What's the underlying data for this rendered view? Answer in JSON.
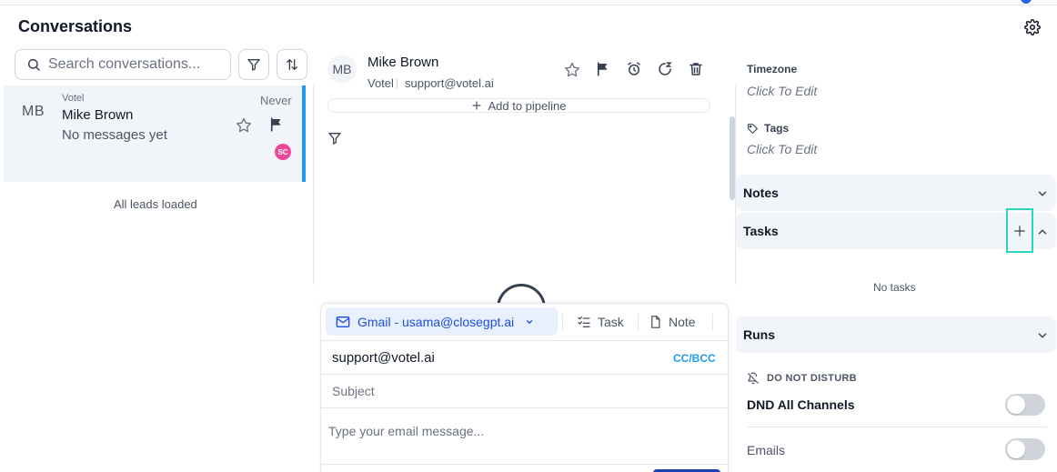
{
  "header": {
    "title": "Conversations"
  },
  "search": {
    "placeholder": "Search conversations..."
  },
  "conversation": {
    "avatar_initials": "MB",
    "company": "Votel",
    "name": "Mike Brown",
    "preview": "No messages yet",
    "time": "Never",
    "badge": "SC"
  },
  "list_status": "All leads loaded",
  "contact": {
    "initials": "MB",
    "name": "Mike Brown",
    "company": "Votel",
    "email": "support@votel.ai",
    "add_pipeline": "Add to pipeline"
  },
  "composer": {
    "channel": "Gmail - usama@closegpt.ai",
    "task_tab": "Task",
    "note_tab": "Note",
    "to": "support@votel.ai",
    "cc_bcc": "CC/BCC",
    "subject_placeholder": "Subject",
    "message_placeholder": "Type your email message..."
  },
  "details": {
    "timezone_label": "Timezone",
    "timezone_value": "Click To Edit",
    "tags_label": "Tags",
    "tags_value": "Click To Edit"
  },
  "sections": {
    "notes": "Notes",
    "tasks": "Tasks",
    "no_tasks": "No tasks",
    "runs": "Runs"
  },
  "dnd": {
    "title": "DO NOT DISTURB",
    "all_channels": "DND All Channels",
    "emails": "Emails",
    "all_channels_on": false,
    "emails_on": false
  },
  "colors": {
    "accent": "#1f9cf0",
    "highlight": "#2dd4bf",
    "badge": "#ec4899"
  }
}
